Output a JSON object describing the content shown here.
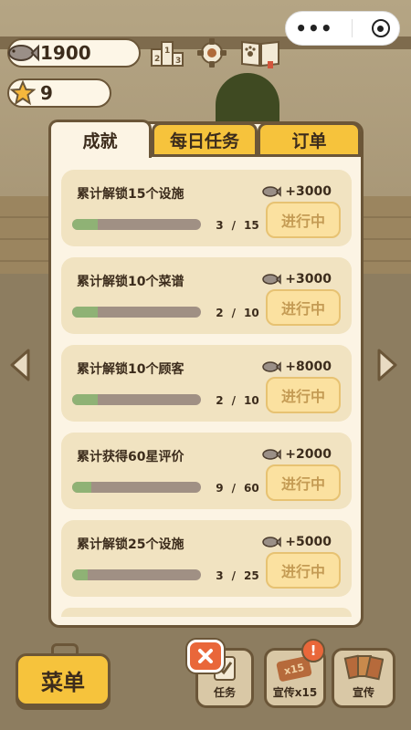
{
  "status": {
    "fish": "1900",
    "stars": "9"
  },
  "capsule": {
    "more_icon": "more-dots-icon",
    "close_icon": "target-circle-icon"
  },
  "toolbar": {
    "icons": [
      "ranking-icon",
      "settings-gear-icon",
      "recipe-book-icon"
    ]
  },
  "tabs": [
    {
      "label": "成就",
      "active": true
    },
    {
      "label": "每日任务",
      "active": false
    },
    {
      "label": "订单",
      "active": false
    }
  ],
  "achievements": [
    {
      "title": "累计解锁15个设施",
      "reward": "+3000",
      "current": "3",
      "sep": "/",
      "total": "15",
      "progress": 0.2,
      "status": "进行中"
    },
    {
      "title": "累计解锁10个菜谱",
      "reward": "+3000",
      "current": "2",
      "sep": "/",
      "total": "10",
      "progress": 0.2,
      "status": "进行中"
    },
    {
      "title": "累计解锁10个顾客",
      "reward": "+8000",
      "current": "2",
      "sep": "/",
      "total": "10",
      "progress": 0.2,
      "status": "进行中"
    },
    {
      "title": "累计获得60星评价",
      "reward": "+2000",
      "current": "9",
      "sep": "/",
      "total": "60",
      "progress": 0.15,
      "status": "进行中"
    },
    {
      "title": "累计解锁25个设施",
      "reward": "+5000",
      "current": "3",
      "sep": "/",
      "total": "25",
      "progress": 0.12,
      "status": "进行中"
    }
  ],
  "bottom": {
    "menu_label": "菜单",
    "task_label": "任务",
    "promo15_label": "宣传x15",
    "promo15_tag": "x15",
    "promo_label": "宣传",
    "alert_badge": "!"
  },
  "colors": {
    "accent_yellow": "#f6c33c",
    "panel_bg": "#fcf4e4",
    "card_bg": "#f1e3c1",
    "progress_fill": "#8fb275",
    "badge_orange": "#e9673a"
  }
}
